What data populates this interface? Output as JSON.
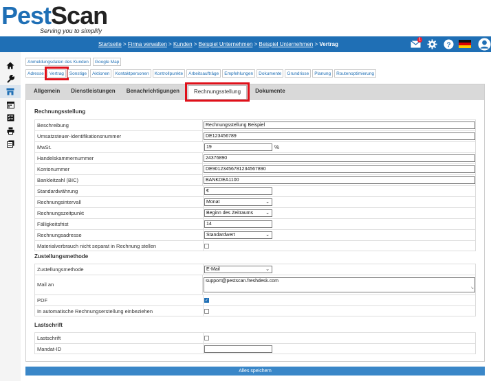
{
  "logo": {
    "part1": "Pest",
    "part2": "Scan",
    "tagline": "Serving you to simplify"
  },
  "breadcrumb": {
    "links": [
      "Startseite",
      "Firma verwalten",
      "Kunden",
      "Beispiel Unternehmen",
      "Beispiel Unternehmen"
    ],
    "separator": " > ",
    "current": "Vertrag"
  },
  "header_icons": {
    "mail_badge": "1"
  },
  "colors": {
    "brand": "#1f6fb5",
    "highlight": "#e0101a"
  },
  "sidebar": [
    "home-icon",
    "wrench-icon",
    "building-icon",
    "calendar-icon",
    "checklist-icon",
    "printer-icon",
    "documents-icon"
  ],
  "tabs_row1": [
    "Anmeldungsdaten des Kunden",
    "Google Map"
  ],
  "tabs_row2": [
    "Adresse",
    "Vertrag",
    "Sonstige",
    "Aktionen",
    "Kontaktpersonen",
    "Kontrollpunkte",
    "Arbeitsaufträge",
    "Empfehlungen",
    "Dokumente",
    "Grundrisse",
    "Planung",
    "Routenoptimierung"
  ],
  "tabs_main": [
    "Allgemein",
    "Dienstleistungen",
    "Benachrichtigungen",
    "Rechnungsstellung",
    "Dokumente"
  ],
  "sections": {
    "billing": {
      "title": "Rechnungsstellung",
      "rows": [
        {
          "label": "Beschreibung",
          "value": "Rechnungsstellung Beispiel"
        },
        {
          "label": "Umsatzsteuer-Identifikationsnummer",
          "value": "DE123456789"
        },
        {
          "label": "MwSt.",
          "value": "19",
          "unit": "%"
        },
        {
          "label": "Handelskammernummer",
          "value": "24376890"
        },
        {
          "label": "Kontonummer",
          "value": "DE90123456781234567890"
        },
        {
          "label": "Bankleitzahl (BIC)",
          "value": "BANKDEA1100"
        },
        {
          "label": "Standardwährung",
          "value": "€"
        },
        {
          "label": "Rechnungsintervall",
          "value": "Monat"
        },
        {
          "label": "Rechnungszeitpunkt",
          "value": "Beginn des Zeitraums"
        },
        {
          "label": "Fälligkeitsfrist",
          "value": "14"
        },
        {
          "label": "Rechnungsadresse",
          "value": "Standardwert"
        },
        {
          "label": "Materialverbrauch nicht separat in Rechnung stellen",
          "checked": false
        }
      ]
    },
    "delivery": {
      "title": "Zustellungsmethode",
      "rows": [
        {
          "label": "Zustellungsmethode",
          "value": "E-Mail"
        },
        {
          "label": "Mail an",
          "value": "support@pestscan.freshdesk.com"
        },
        {
          "label": "PDF",
          "checked": true
        },
        {
          "label": "In automatische Rechnungserstellung einbeziehen",
          "checked": false
        }
      ]
    },
    "debit": {
      "title": "Lastschrift",
      "rows": [
        {
          "label": "Lastschrift",
          "checked": false
        },
        {
          "label": "Mandat-ID",
          "value": ""
        }
      ]
    }
  },
  "save_button": "Alles speichern"
}
